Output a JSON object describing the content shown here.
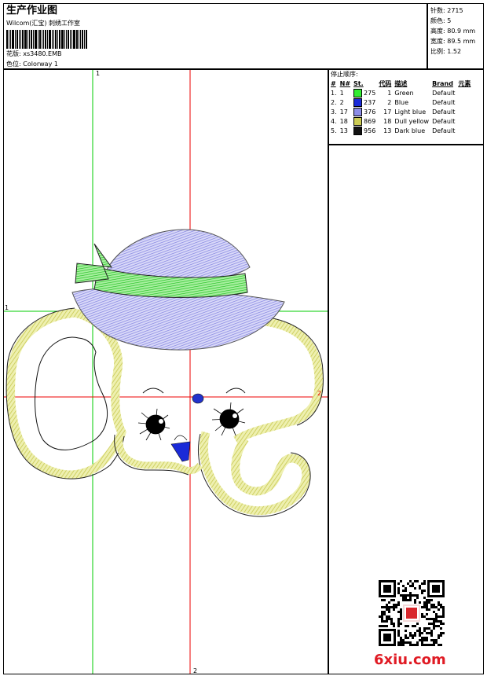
{
  "header": {
    "title": "生产作业图",
    "company": "Wilcom(汇宝) 刺绣工作室",
    "design_name": "花版: xs3480.EMB",
    "colorway": "色位: Colorway 1"
  },
  "stats": [
    "针数: 2715",
    "颜色: 5",
    "高度: 80.9 mm",
    "宽度: 89.5 mm",
    "比例: 1.52"
  ],
  "stops": {
    "title": "停止顺序:",
    "headers": [
      "#",
      "N#",
      "St.",
      "代码",
      "描述",
      "Brand",
      "元素"
    ],
    "rows": [
      {
        "idx": "1.",
        "n": "1",
        "stitches": "275",
        "code": "1",
        "desc": "Green",
        "brand": "Default",
        "color": "#33ee33"
      },
      {
        "idx": "2.",
        "n": "2",
        "stitches": "237",
        "code": "2",
        "desc": "Blue",
        "brand": "Default",
        "color": "#1a2ad8"
      },
      {
        "idx": "3.",
        "n": "17",
        "stitches": "376",
        "code": "17",
        "desc": "Light blue",
        "brand": "Default",
        "color": "#8c8ce6"
      },
      {
        "idx": "4.",
        "n": "18",
        "stitches": "869",
        "code": "18",
        "desc": "Dull yellow",
        "brand": "Default",
        "color": "#cccc55"
      },
      {
        "idx": "5.",
        "n": "13",
        "stitches": "956",
        "code": "13",
        "desc": "Dark blue",
        "brand": "Default",
        "color": "#111111"
      }
    ]
  },
  "guides": {
    "v_green_label": "1",
    "h_green_label": "1",
    "v_red_label": "2",
    "h_red_label": "2"
  },
  "watermark": "6xiu.com"
}
